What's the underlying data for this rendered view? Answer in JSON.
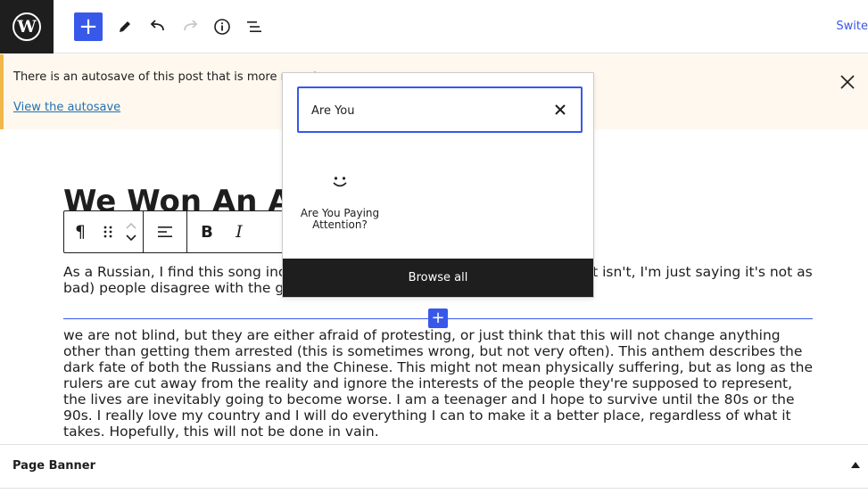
{
  "toolbar": {
    "add_icon": "plus-icon",
    "tools_icon": "pencil-icon",
    "undo_icon": "undo-icon",
    "redo_icon": "redo-icon",
    "details_icon": "info-icon",
    "list_view_icon": "list-view-icon",
    "switch_label": "Swite"
  },
  "notice": {
    "text": "There is an autosave of this post that is more recent",
    "link": "View the autosave"
  },
  "editor": {
    "title": "We Won An A",
    "paragraph1": "As a Russian, I find this song incredibly                                                                  oppressive as China (I'm not saying it isn't, I'm just saying it's not as bad)                                                                    people disagree with the government,",
    "paragraph2": "we are not blind, but they are either afraid of protesting, or just think that this will not change anything other than getting them arrested (this is sometimes wrong, but not very often). This anthem describes the dark fate of both the Russians and the Chinese. This might not mean physically suffering, but as long as the rulers are cut away from the reality and ignore the interests of the people they're supposed to represent, the lives are inevitably going to become worse. I am a teenager and I hope to survive until the 80s or the 90s. I really love my country and I will do everything I can to make it a better place, regardless of what it takes. Hopefully, this will not be done in vain."
  },
  "block_toolbar": {
    "paragraph_icon": "¶",
    "bold": "B",
    "italic": "I"
  },
  "inserter": {
    "search_value": "Are You",
    "result_label": "Are You Paying Attention?",
    "browse_all": "Browse all"
  },
  "panel": {
    "title": "Page Banner"
  }
}
